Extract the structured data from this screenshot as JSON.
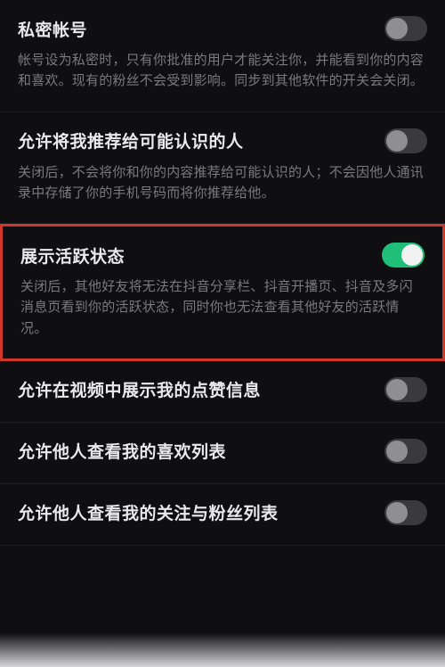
{
  "settings": [
    {
      "key": "private-account",
      "title": "私密帐号",
      "desc": "帐号设为私密时，只有你批准的用户才能关注你，并能看到你的内容和喜欢。现有的粉丝不会受到影响。同步到其他软件的开关会关闭。",
      "state": "off",
      "highlighted": false
    },
    {
      "key": "recommend-contacts",
      "title": "允许将我推荐给可能认识的人",
      "desc": "关闭后，不会将你和你的内容推荐给可能认识的人；不会因他人通讯录中存储了你的手机号码而将你推荐给他。",
      "state": "off",
      "highlighted": false
    },
    {
      "key": "activity-status",
      "title": "展示活跃状态",
      "desc": "关闭后，其他好友将无法在抖音分享栏、抖音开播页、抖音及多闪消息页看到你的活跃状态，同时你也无法查看其他好友的活跃情况。",
      "state": "on",
      "highlighted": true
    },
    {
      "key": "show-likes-in-video",
      "title": "允许在视频中展示我的点赞信息",
      "desc": "",
      "state": "off",
      "highlighted": false
    },
    {
      "key": "allow-view-likes",
      "title": "允许他人查看我的喜欢列表",
      "desc": "",
      "state": "off",
      "highlighted": false
    },
    {
      "key": "allow-view-follows",
      "title": "允许他人查看我的关注与粉丝列表",
      "desc": "",
      "state": "off",
      "highlighted": false
    }
  ],
  "cutoff_title_partial": ""
}
